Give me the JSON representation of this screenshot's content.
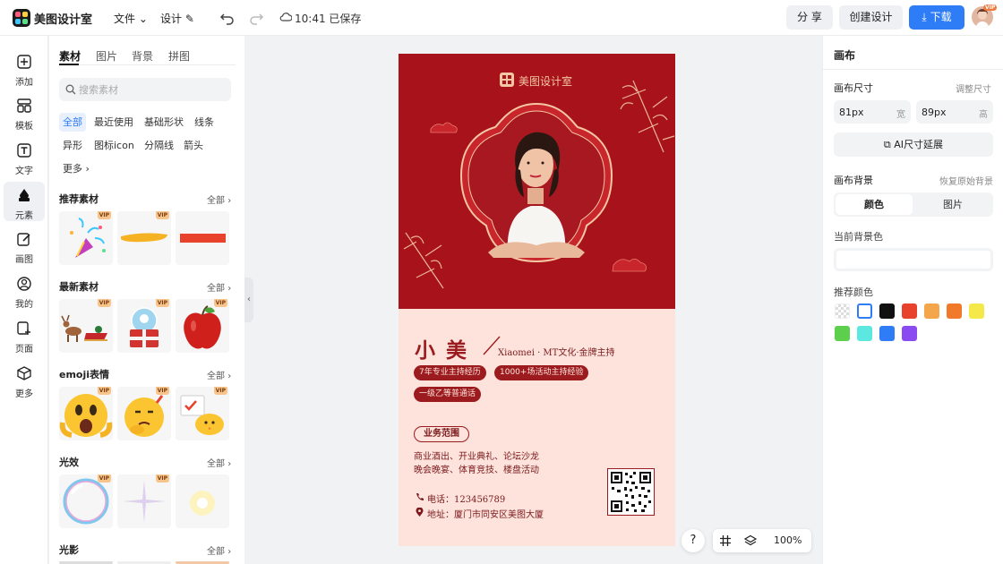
{
  "app": {
    "brand": "美图设计室"
  },
  "topbar": {
    "file_menu": "文件",
    "design_menu": "设计",
    "save_status": "10:41 已保存",
    "share": "分 享",
    "create": "创建设计",
    "download": "下载",
    "vip_badge": "VIP"
  },
  "rail": [
    {
      "label": "添加",
      "icon": "plus-square-icon"
    },
    {
      "label": "模板",
      "icon": "template-icon"
    },
    {
      "label": "文字",
      "icon": "text-icon"
    },
    {
      "label": "元素",
      "icon": "shapes-icon"
    },
    {
      "label": "画图",
      "icon": "pencil-icon"
    },
    {
      "label": "我的",
      "icon": "user-icon"
    },
    {
      "label": "页面",
      "icon": "page-add-icon"
    },
    {
      "label": "更多",
      "icon": "box-icon"
    }
  ],
  "panel": {
    "tabs": [
      "素材",
      "图片",
      "背景",
      "拼图"
    ],
    "search_placeholder": "搜索素材",
    "chips": [
      "全部",
      "最近使用",
      "基础形状",
      "线条",
      "异形",
      "图标icon",
      "分隔线",
      "箭头",
      "更多"
    ],
    "all": "全部",
    "vip": "VIP",
    "sections": [
      "推荐素材",
      "最新素材",
      "emoji表情",
      "光效",
      "光影"
    ]
  },
  "card": {
    "brand": "美图设计室",
    "name": "小 美",
    "subtitle": "Xiaomei · MT文化·金牌主持",
    "tags": [
      "7年专业主持经历",
      "1000+场活动主持经验",
      "一级乙等普通话"
    ],
    "scope_label": "业务范围",
    "scope_lines": [
      "商业酒出、开业典礼、论坛沙龙",
      "晚会晚宴、体育竞技、楼盘活动"
    ],
    "phone": "电话：123456789",
    "address": "地址：厦门市同安区美图大厦"
  },
  "right": {
    "title": "画布",
    "size_label": "画布尺寸",
    "resize_link": "调整尺寸",
    "width_value": "81px",
    "width_unit": "宽",
    "height_value": "89px",
    "height_unit": "高",
    "ai_extend": "AI尺寸延展",
    "bg_label": "画布背景",
    "restore": "恢复原始背景",
    "seg_color": "颜色",
    "seg_image": "图片",
    "current_bg": "当前背景色",
    "recommend": "推荐颜色",
    "swatches": [
      "transparent",
      "#ffffff",
      "#111111",
      "#e8412c",
      "#f5a64a",
      "#f07a2a",
      "#f5e94a",
      "#5ccf4c",
      "#5ce8e0",
      "#2e7cf6",
      "#8a4cf0"
    ]
  },
  "zoom": {
    "help": "?",
    "level": "100%"
  }
}
